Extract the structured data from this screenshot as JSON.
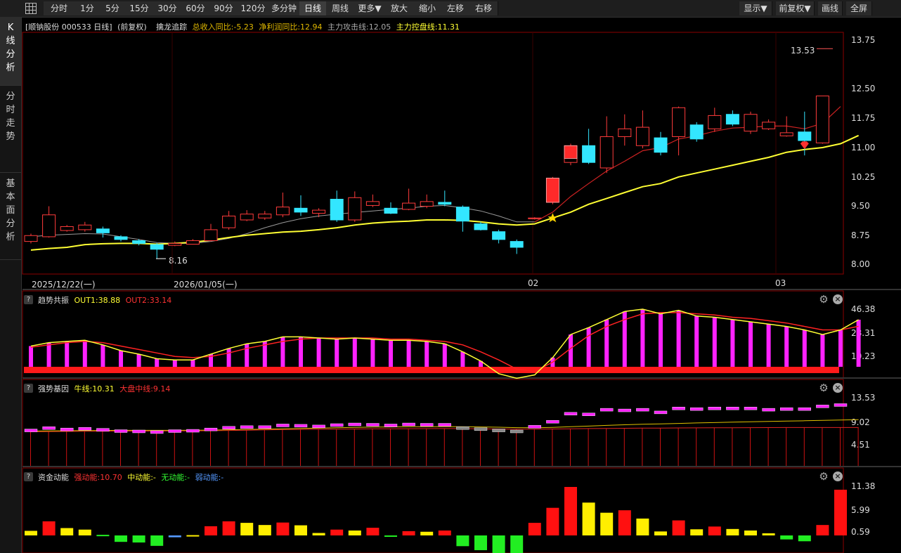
{
  "toolbar": {
    "grid_icon": "grid-icon",
    "periods": [
      "分时",
      "1分",
      "5分",
      "15分",
      "30分",
      "60分",
      "90分",
      "120分",
      "多分钟",
      "日线",
      "周线",
      "更多▼",
      "放大",
      "缩小",
      "左移",
      "右移"
    ],
    "active": "日线",
    "right": [
      "显示▼",
      "前复权▼",
      "画线",
      "全屏"
    ]
  },
  "sidebar": {
    "tabs": [
      {
        "label": "K线分析",
        "active": true
      },
      {
        "label": "分时走势",
        "active": false
      },
      {
        "label": "基本面分析",
        "active": false
      }
    ]
  },
  "main": {
    "stock_label": "[顺钠股份 000533 日线]",
    "adjust_label": "(前复权)",
    "indicator_name": "擒龙追踪",
    "fields": [
      {
        "text": "总收入同比:-5.23",
        "color": "#e0b800"
      },
      {
        "text": "净利润同比:12.94",
        "color": "#e0b800"
      },
      {
        "text": "主力攻击线:12.05",
        "color": "#aaaaaa"
      },
      {
        "text": "主力控盘线:11.31",
        "color": "#ffff33"
      }
    ],
    "y_ticks": [
      "13.75",
      "12.50",
      "11.75",
      "11.00",
      "10.25",
      "9.50",
      "8.75",
      "8.00"
    ],
    "x_labels": [
      "2025/12/22(一)",
      "2026/01/05(一)",
      "02",
      "03"
    ],
    "high_label": "13.53",
    "low_label": "8.16"
  },
  "panel1": {
    "name": "趋势共振",
    "fields": [
      {
        "text": "OUT1:38.88",
        "color": "#ffff33"
      },
      {
        "text": "OUT2:33.14",
        "color": "#ff3333"
      }
    ],
    "y_ticks": [
      "46.38",
      "28.31",
      "10.23"
    ]
  },
  "panel2": {
    "name": "强势基因",
    "fields": [
      {
        "text": "牛线:10.31",
        "color": "#ffff33"
      },
      {
        "text": "大盘中线:9.14",
        "color": "#ff3333"
      }
    ],
    "y_ticks": [
      "13.53",
      "9.02",
      "4.51"
    ]
  },
  "panel3": {
    "name": "资金动能",
    "fields": [
      {
        "text": "强动能:10.70",
        "color": "#ff3333"
      },
      {
        "text": "中动能:-",
        "color": "#ffff33"
      },
      {
        "text": "无动能:-",
        "color": "#33ff33"
      },
      {
        "text": "弱动能:-",
        "color": "#5599ff"
      }
    ],
    "y_ticks": [
      "11.38",
      "5.99",
      "0.59"
    ]
  },
  "chart_data": {
    "type": "candlestick",
    "candles": [
      {
        "o": 8.6,
        "c": 8.75,
        "h": 8.8,
        "l": 8.55
      },
      {
        "o": 8.72,
        "c": 9.28,
        "h": 9.5,
        "l": 8.7
      },
      {
        "o": 8.88,
        "c": 8.98,
        "h": 9.02,
        "l": 8.85
      },
      {
        "o": 8.9,
        "c": 9.02,
        "h": 9.1,
        "l": 8.85
      },
      {
        "o": 8.92,
        "c": 8.82,
        "h": 8.98,
        "l": 8.7
      },
      {
        "o": 8.72,
        "c": 8.65,
        "h": 8.76,
        "l": 8.6
      },
      {
        "o": 8.62,
        "c": 8.55,
        "h": 8.66,
        "l": 8.5
      },
      {
        "o": 8.52,
        "c": 8.4,
        "h": 8.56,
        "l": 8.16
      },
      {
        "o": 8.5,
        "c": 8.55,
        "h": 8.6,
        "l": 8.48
      },
      {
        "o": 8.53,
        "c": 8.62,
        "h": 8.66,
        "l": 8.52
      },
      {
        "o": 8.62,
        "c": 8.9,
        "h": 9.05,
        "l": 8.6
      },
      {
        "o": 8.95,
        "c": 9.25,
        "h": 9.38,
        "l": 8.9
      },
      {
        "o": 9.15,
        "c": 9.3,
        "h": 9.4,
        "l": 9.12
      },
      {
        "o": 9.2,
        "c": 9.3,
        "h": 9.38,
        "l": 9.15
      },
      {
        "o": 9.28,
        "c": 9.48,
        "h": 9.85,
        "l": 9.22
      },
      {
        "o": 9.45,
        "c": 9.35,
        "h": 9.78,
        "l": 9.25
      },
      {
        "o": 9.32,
        "c": 9.4,
        "h": 9.45,
        "l": 9.22
      },
      {
        "o": 9.68,
        "c": 9.15,
        "h": 9.9,
        "l": 9.1
      },
      {
        "o": 9.15,
        "c": 9.72,
        "h": 9.88,
        "l": 9.1
      },
      {
        "o": 9.52,
        "c": 9.62,
        "h": 9.8,
        "l": 9.48
      },
      {
        "o": 9.45,
        "c": 9.32,
        "h": 9.6,
        "l": 9.3
      },
      {
        "o": 9.42,
        "c": 9.58,
        "h": 9.95,
        "l": 9.4
      },
      {
        "o": 9.5,
        "c": 9.62,
        "h": 9.8,
        "l": 9.45
      },
      {
        "o": 9.6,
        "c": 9.55,
        "h": 9.9,
        "l": 9.5
      },
      {
        "o": 9.48,
        "c": 9.12,
        "h": 9.52,
        "l": 8.85
      },
      {
        "o": 9.05,
        "c": 8.9,
        "h": 9.1,
        "l": 8.88
      },
      {
        "o": 8.85,
        "c": 8.65,
        "h": 8.9,
        "l": 8.55
      },
      {
        "o": 8.6,
        "c": 8.45,
        "h": 8.65,
        "l": 8.28
      },
      {
        "o": 9.18,
        "c": 9.2,
        "h": 9.22,
        "l": 9.16
      },
      {
        "o": 9.6,
        "c": 10.22,
        "h": 10.25,
        "l": 9.55
      },
      {
        "o": 10.62,
        "c": 11.05,
        "h": 11.1,
        "l": 10.55
      },
      {
        "o": 11.05,
        "c": 10.62,
        "h": 11.48,
        "l": 10.58
      },
      {
        "o": 10.48,
        "c": 11.28,
        "h": 11.8,
        "l": 10.35
      },
      {
        "o": 11.28,
        "c": 11.48,
        "h": 11.85,
        "l": 11.05
      },
      {
        "o": 11.05,
        "c": 11.52,
        "h": 11.95,
        "l": 10.98
      },
      {
        "o": 11.25,
        "c": 10.88,
        "h": 11.4,
        "l": 10.8
      },
      {
        "o": 11.28,
        "c": 12.02,
        "h": 12.05,
        "l": 10.8
      },
      {
        "o": 11.58,
        "c": 11.22,
        "h": 11.65,
        "l": 11.15
      },
      {
        "o": 11.48,
        "c": 11.82,
        "h": 12.02,
        "l": 11.4
      },
      {
        "o": 11.85,
        "c": 11.6,
        "h": 11.95,
        "l": 11.55
      },
      {
        "o": 11.42,
        "c": 11.85,
        "h": 11.92,
        "l": 11.35
      },
      {
        "o": 11.48,
        "c": 11.65,
        "h": 11.72,
        "l": 11.45
      },
      {
        "o": 11.3,
        "c": 11.38,
        "h": 11.8,
        "l": 11.28
      },
      {
        "o": 11.4,
        "c": 11.18,
        "h": 11.92,
        "l": 10.8
      },
      {
        "o": 11.12,
        "c": 12.32,
        "h": 12.32,
        "l": 11.1
      }
    ],
    "ma_attack": [
      8.72,
      8.76,
      8.78,
      8.8,
      8.79,
      8.72,
      8.65,
      8.57,
      8.55,
      8.55,
      8.6,
      8.68,
      8.8,
      8.95,
      9.08,
      9.18,
      9.25,
      9.3,
      9.34,
      9.38,
      9.42,
      9.45,
      9.5,
      9.52,
      9.46,
      9.38,
      9.25,
      9.1,
      9.1,
      9.35,
      9.75,
      10.08,
      10.4,
      10.65,
      10.92,
      11.0,
      11.22,
      11.3,
      11.42,
      11.5,
      11.52,
      11.55,
      11.55,
      11.48,
      11.62,
      12.05
    ],
    "ma_control": [
      8.38,
      8.42,
      8.45,
      8.52,
      8.54,
      8.55,
      8.55,
      8.53,
      8.55,
      8.58,
      8.63,
      8.7,
      8.76,
      8.8,
      8.84,
      8.86,
      8.9,
      8.95,
      9.02,
      9.07,
      9.1,
      9.12,
      9.15,
      9.15,
      9.14,
      9.1,
      9.05,
      9.02,
      9.05,
      9.2,
      9.35,
      9.55,
      9.7,
      9.85,
      10.0,
      10.08,
      10.25,
      10.35,
      10.45,
      10.55,
      10.65,
      10.75,
      10.88,
      10.95,
      11.0,
      11.1,
      11.31
    ],
    "p1_out1": [
      16,
      19,
      20,
      21,
      17,
      12,
      9,
      5,
      4,
      4,
      9,
      14,
      18,
      20,
      24,
      24,
      23,
      22,
      23,
      22,
      21,
      21,
      20,
      18,
      11,
      3,
      -8,
      -12,
      -9,
      6,
      26,
      32,
      39,
      46,
      48,
      44,
      47,
      42,
      41,
      39,
      37,
      35,
      33,
      30,
      26,
      30,
      38.88
    ],
    "p1_out2": [
      15,
      17,
      19,
      20,
      19,
      16,
      13,
      10,
      7,
      6,
      7,
      10,
      14,
      17,
      20,
      22,
      23,
      23,
      23,
      23,
      22,
      22,
      21,
      20,
      17,
      11,
      4,
      -4,
      -6,
      2,
      14,
      25,
      33,
      39,
      44,
      45,
      45,
      44,
      43,
      41,
      40,
      38,
      36,
      33,
      30,
      30,
      33.14
    ],
    "p1_bars": [
      16,
      19,
      20,
      21,
      17,
      12,
      9,
      5,
      4,
      4,
      9,
      14,
      18,
      20,
      24,
      24,
      23,
      22,
      23,
      22,
      21,
      21,
      20,
      18,
      11,
      3,
      0,
      0,
      0,
      6,
      26,
      32,
      39,
      46,
      48,
      44,
      47,
      42,
      41,
      39,
      37,
      35,
      33,
      30,
      26,
      30,
      38.88
    ],
    "p2_bars": [
      8.7,
      9.05,
      8.85,
      8.95,
      8.8,
      8.6,
      8.55,
      8.45,
      8.6,
      8.65,
      8.85,
      9.1,
      9.2,
      9.2,
      9.45,
      9.4,
      9.3,
      9.5,
      9.6,
      9.55,
      9.45,
      9.6,
      9.55,
      9.55,
      9.05,
      8.9,
      8.7,
      8.55,
      9.25,
      10.0,
      11.2,
      11.1,
      11.8,
      11.7,
      11.8,
      11.4,
      12.0,
      11.9,
      12.0,
      12.0,
      12.0,
      11.8,
      11.9,
      11.9,
      12.3,
      12.5
    ],
    "p2_bull": [
      8.6,
      8.62,
      8.65,
      8.68,
      8.7,
      8.72,
      8.72,
      8.72,
      8.72,
      8.73,
      8.75,
      8.8,
      8.85,
      8.9,
      8.95,
      9.0,
      9.05,
      9.1,
      9.15,
      9.2,
      9.22,
      9.25,
      9.27,
      9.28,
      9.26,
      9.22,
      9.18,
      9.12,
      9.1,
      9.15,
      9.25,
      9.35,
      9.45,
      9.55,
      9.62,
      9.68,
      9.75,
      9.82,
      9.88,
      9.95,
      10.0,
      10.05,
      10.1,
      10.15,
      10.2,
      10.25,
      10.31
    ],
    "p2_market": [
      8.5,
      8.52,
      8.55,
      8.57,
      8.58,
      8.6,
      8.6,
      8.6,
      8.62,
      8.63,
      8.66,
      8.7,
      8.74,
      8.78,
      8.82,
      8.85,
      8.88,
      8.9,
      8.92,
      8.94,
      8.95,
      8.96,
      8.97,
      8.98,
      8.97,
      8.95,
      8.92,
      8.9,
      8.9,
      8.92,
      8.95,
      8.98,
      9.0,
      9.02,
      9.04,
      9.06,
      9.08,
      9.09,
      9.1,
      9.11,
      9.12,
      9.13,
      9.14,
      9.14,
      9.14,
      9.14,
      9.14
    ],
    "p3_bars": [
      {
        "v": 1.5,
        "c": "y"
      },
      {
        "v": 4.6,
        "c": "r"
      },
      {
        "v": 2.4,
        "c": "y"
      },
      {
        "v": 1.9,
        "c": "y"
      },
      {
        "v": 0.2,
        "c": "g"
      },
      {
        "v": -2.1,
        "c": "g"
      },
      {
        "v": -2.3,
        "c": "g"
      },
      {
        "v": -3.4,
        "c": "g"
      },
      {
        "v": -0.6,
        "c": "b"
      },
      {
        "v": 0.1,
        "c": "y"
      },
      {
        "v": 3.0,
        "c": "r"
      },
      {
        "v": 4.6,
        "c": "r"
      },
      {
        "v": 4.1,
        "c": "y"
      },
      {
        "v": 3.4,
        "c": "y"
      },
      {
        "v": 4.2,
        "c": "r"
      },
      {
        "v": 3.3,
        "c": "y"
      },
      {
        "v": 0.8,
        "c": "y"
      },
      {
        "v": 1.9,
        "c": "r"
      },
      {
        "v": 1.6,
        "c": "y"
      },
      {
        "v": 2.5,
        "c": "r"
      },
      {
        "v": -0.4,
        "c": "g"
      },
      {
        "v": 1.4,
        "c": "r"
      },
      {
        "v": 1.2,
        "c": "y"
      },
      {
        "v": 1.6,
        "c": "r"
      },
      {
        "v": -3.5,
        "c": "g"
      },
      {
        "v": -4.8,
        "c": "g"
      },
      {
        "v": -5.9,
        "c": "g"
      },
      {
        "v": -6.1,
        "c": "g"
      },
      {
        "v": 4.1,
        "c": "r"
      },
      {
        "v": 9.0,
        "c": "r"
      },
      {
        "v": 15.8,
        "c": "r"
      },
      {
        "v": 10.7,
        "c": "y"
      },
      {
        "v": 7.4,
        "c": "y"
      },
      {
        "v": 8.2,
        "c": "r"
      },
      {
        "v": 5.5,
        "c": "y"
      },
      {
        "v": 1.3,
        "c": "y"
      },
      {
        "v": 4.9,
        "c": "r"
      },
      {
        "v": 2.0,
        "c": "y"
      },
      {
        "v": 2.9,
        "c": "r"
      },
      {
        "v": 2.1,
        "c": "y"
      },
      {
        "v": 1.6,
        "c": "y"
      },
      {
        "v": 0.7,
        "c": "y"
      },
      {
        "v": -1.3,
        "c": "g"
      },
      {
        "v": -1.9,
        "c": "g"
      },
      {
        "v": 3.4,
        "c": "r"
      },
      {
        "v": 14.9,
        "c": "r"
      }
    ]
  }
}
